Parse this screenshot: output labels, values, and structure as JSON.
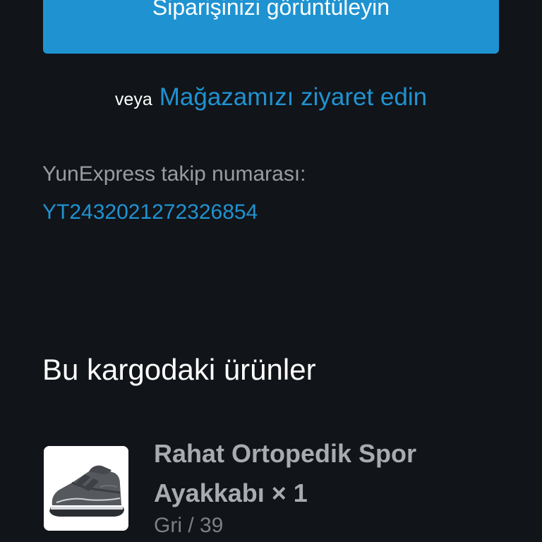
{
  "order": {
    "view_order_button_label": "Siparişinizi görüntüleyin",
    "or_text": "veya",
    "visit_store_link": "Mağazamızı ziyaret edin"
  },
  "tracking": {
    "label": "YunExpress takip numarası:",
    "number": "YT2432021272326854"
  },
  "shipment": {
    "title": "Bu kargodaki ürünler",
    "items": [
      {
        "name": "Rahat Ortopedik Spor Ayakkabı × 1",
        "variant": "Gri / 39",
        "image_icon": "sneaker-image"
      }
    ]
  },
  "colors": {
    "background": "#111419",
    "accent": "#1f93d1",
    "text_primary": "#ffffff",
    "text_muted": "#9a9ca0"
  }
}
